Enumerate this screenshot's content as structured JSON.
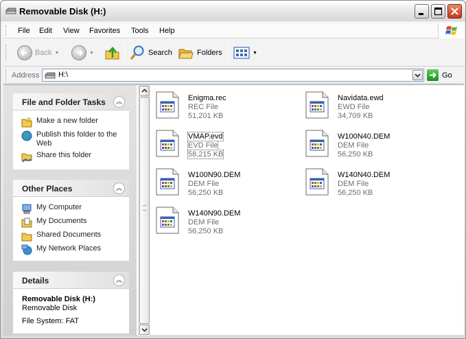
{
  "window": {
    "title": "Removable Disk (H:)"
  },
  "menu": [
    "File",
    "Edit",
    "View",
    "Favorites",
    "Tools",
    "Help"
  ],
  "toolbar": {
    "back": "Back",
    "search": "Search",
    "folders": "Folders"
  },
  "address": {
    "label": "Address",
    "value": "H:\\",
    "go": "Go"
  },
  "tasks": {
    "file_folder": {
      "title": "File and Folder Tasks",
      "items": [
        "Make a new folder",
        "Publish this folder to the Web",
        "Share this folder"
      ]
    },
    "other_places": {
      "title": "Other Places",
      "items": [
        "My Computer",
        "My Documents",
        "Shared Documents",
        "My Network Places"
      ]
    },
    "details": {
      "title": "Details",
      "name": "Removable Disk (H:)",
      "type": "Removable Disk",
      "filesystem": "File System: FAT"
    }
  },
  "files": [
    {
      "name": "Enigma.rec",
      "type": "REC File",
      "size": "51,201 KB"
    },
    {
      "name": "Navidata.ewd",
      "type": "EWD File",
      "size": "34,709 KB"
    },
    {
      "name": "VMAP.evd",
      "type": "EVD File",
      "size": "58,215 KB"
    },
    {
      "name": "W100N40.DEM",
      "type": "DEM File",
      "size": "56,250 KB"
    },
    {
      "name": "W100N90.DEM",
      "type": "DEM File",
      "size": "56,250 KB"
    },
    {
      "name": "W140N40.DEM",
      "type": "DEM File",
      "size": "56,250 KB"
    },
    {
      "name": "W140N90.DEM",
      "type": "DEM File",
      "size": "56,250 KB"
    }
  ],
  "icons": {
    "drive": "removable-drive-icon",
    "file": "generic-file-icon",
    "back": "back-arrow-icon",
    "forward": "forward-arrow-icon",
    "up": "up-folder-icon",
    "search": "search-icon",
    "folders": "folders-icon",
    "views": "views-icon",
    "go": "go-arrow-icon",
    "windows_logo": "windows-logo-icon"
  }
}
